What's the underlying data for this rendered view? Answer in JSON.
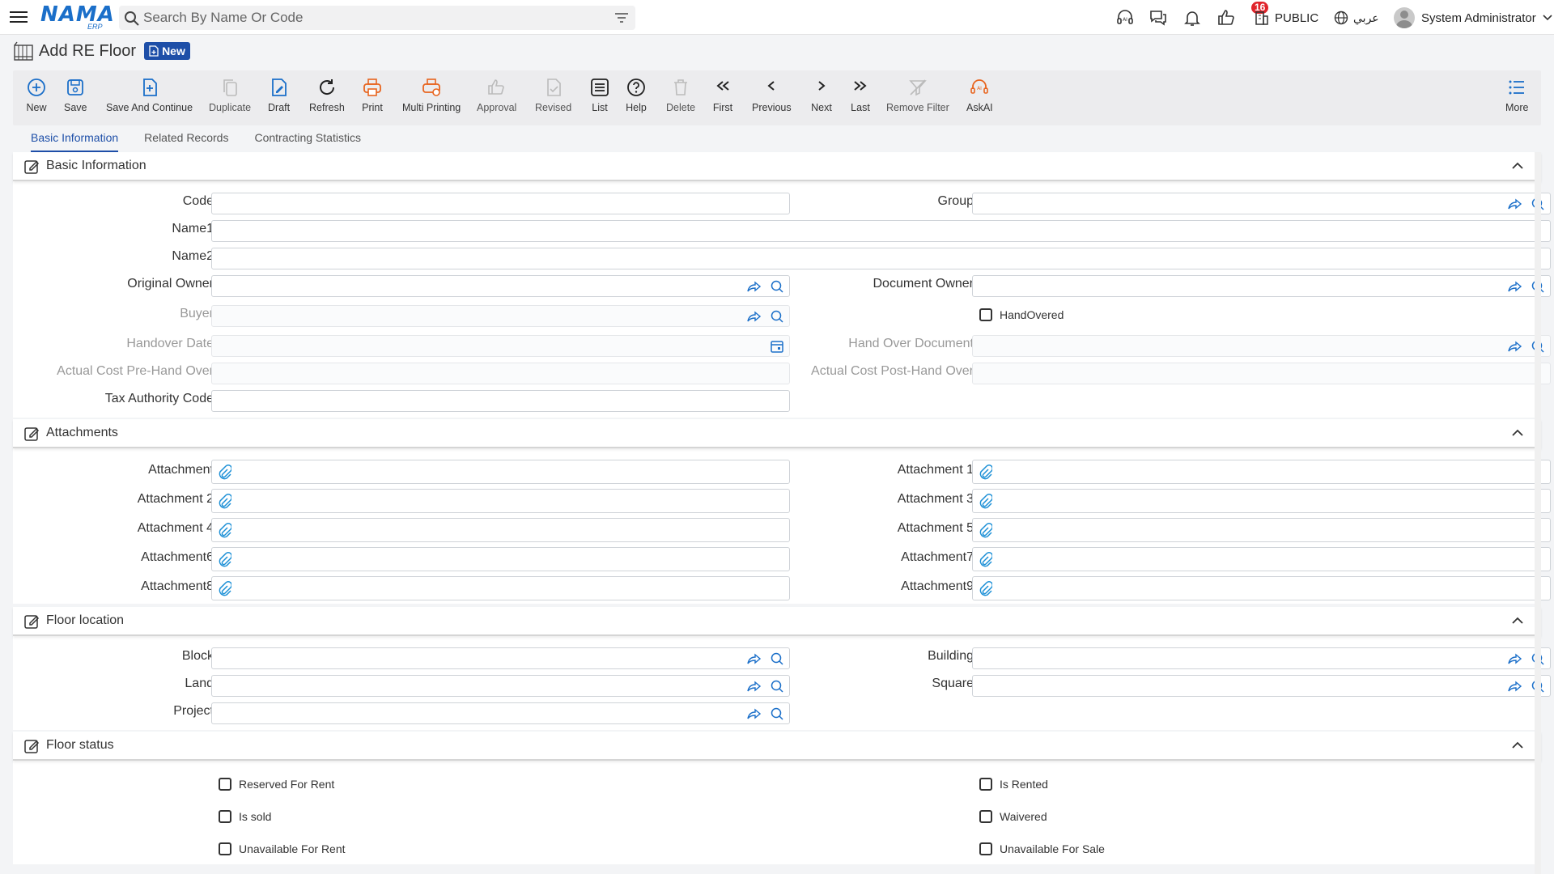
{
  "header": {
    "search_placeholder": "Search By Name Or Code",
    "notification_count": "16",
    "company": "PUBLIC",
    "language": "عربي",
    "user": "System Administrator"
  },
  "page": {
    "title": "Add RE Floor",
    "mode_badge": "New"
  },
  "toolbar": {
    "new": "New",
    "save": "Save",
    "save_continue": "Save And Continue",
    "duplicate": "Duplicate",
    "draft": "Draft",
    "refresh": "Refresh",
    "print": "Print",
    "multi_printing": "Multi Printing",
    "approval": "Approval",
    "revised": "Revised",
    "list": "List",
    "help": "Help",
    "delete": "Delete",
    "first": "First",
    "previous": "Previous",
    "next": "Next",
    "last": "Last",
    "remove_filter": "Remove Filter",
    "askai": "AskAI",
    "more": "More"
  },
  "tabs": [
    "Basic Information",
    "Related Records",
    "Contracting Statistics"
  ],
  "basic": {
    "title": "Basic Information",
    "code": "Code",
    "group": "Group",
    "name1": "Name1",
    "name2": "Name2",
    "original_owner": "Original Owner",
    "document_owner": "Document Owner",
    "buyer": "Buyer",
    "handovered": "HandOvered",
    "handover_date": "Handover Date",
    "hand_over_document": "Hand Over Document",
    "actual_cost_pre": "Actual Cost Pre-Hand Over",
    "actual_cost_post": "Actual Cost Post-Hand Over",
    "tax_authority_code": "Tax Authority Code"
  },
  "attachments": {
    "title": "Attachments",
    "a0": "Attachment",
    "a1": "Attachment 1",
    "a2": "Attachment 2",
    "a3": "Attachment 3",
    "a4": "Attachment 4",
    "a5": "Attachment 5",
    "a6": "Attachment6",
    "a7": "Attachment7",
    "a8": "Attachment8",
    "a9": "Attachment9"
  },
  "location": {
    "title": "Floor location",
    "block": "Block",
    "building": "Building",
    "land": "Land",
    "square": "Square",
    "project": "Project"
  },
  "status": {
    "title": "Floor status",
    "reserved_for_rent": "Reserved For Rent",
    "is_rented": "Is Rented",
    "is_sold": "Is sold",
    "waivered": "Waivered",
    "unavailable_for_rent": "Unavailable For Rent",
    "unavailable_for_sale": "Unavailable For Sale"
  }
}
